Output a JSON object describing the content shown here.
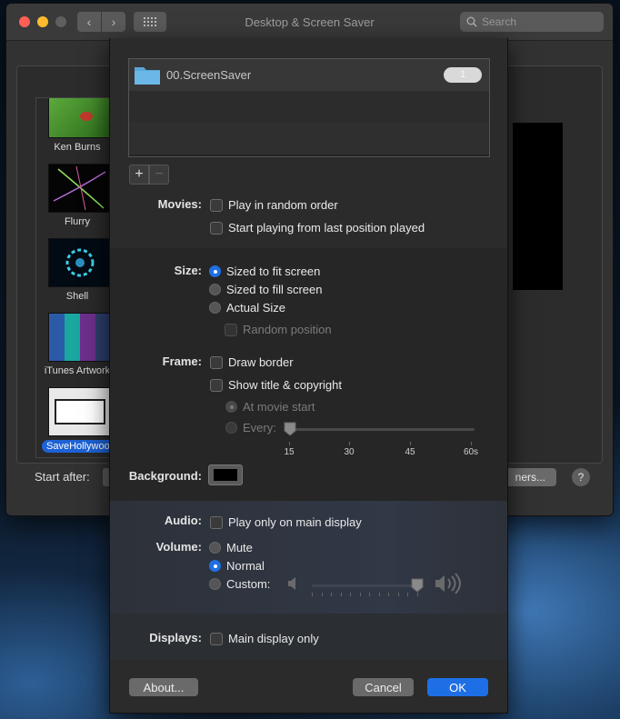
{
  "window": {
    "title": "Desktop & Screen Saver",
    "search_placeholder": "Search",
    "nav_back": "‹",
    "nav_forward": "›"
  },
  "screen_savers": [
    {
      "label": "Ken Burns"
    },
    {
      "label": "Flurry"
    },
    {
      "label": "Shell"
    },
    {
      "label": "iTunes Artwork"
    },
    {
      "label": "SaveHollywood",
      "selected": true
    }
  ],
  "bottom_bar": {
    "start_after_label": "Start after:",
    "options_button": "ners...",
    "help_button": "?"
  },
  "sheet": {
    "folder_list": [
      {
        "name": "00.ScreenSaver",
        "count": "1"
      }
    ],
    "add_button": "+",
    "remove_button": "−",
    "movies": {
      "label": "Movies:",
      "play_random": "Play in random order",
      "start_last": "Start playing from last position played"
    },
    "size": {
      "label": "Size:",
      "fit": "Sized to fit screen",
      "fill": "Sized to fill screen",
      "actual": "Actual Size",
      "random_position": "Random position",
      "selected": "fit"
    },
    "frame": {
      "label": "Frame:",
      "draw_border": "Draw border",
      "show_title": "Show title & copyright",
      "at_movie_start": "At movie start",
      "every": "Every:",
      "ticks": [
        "15",
        "30",
        "45",
        "60s"
      ],
      "slider_value": 15
    },
    "background": {
      "label": "Background:",
      "color": "#000000"
    },
    "audio": {
      "label": "Audio:",
      "main_display": "Play only on main display"
    },
    "volume": {
      "label": "Volume:",
      "mute": "Mute",
      "normal": "Normal",
      "custom": "Custom:",
      "selected": "normal",
      "level": 0.82
    },
    "displays": {
      "label": "Displays:",
      "main_only": "Main display only"
    },
    "buttons": {
      "about": "About...",
      "cancel": "Cancel",
      "ok": "OK"
    }
  },
  "colors": {
    "accent": "#1e6fe6",
    "traffic_red": "#ff5f57",
    "traffic_yellow": "#febc2e"
  }
}
